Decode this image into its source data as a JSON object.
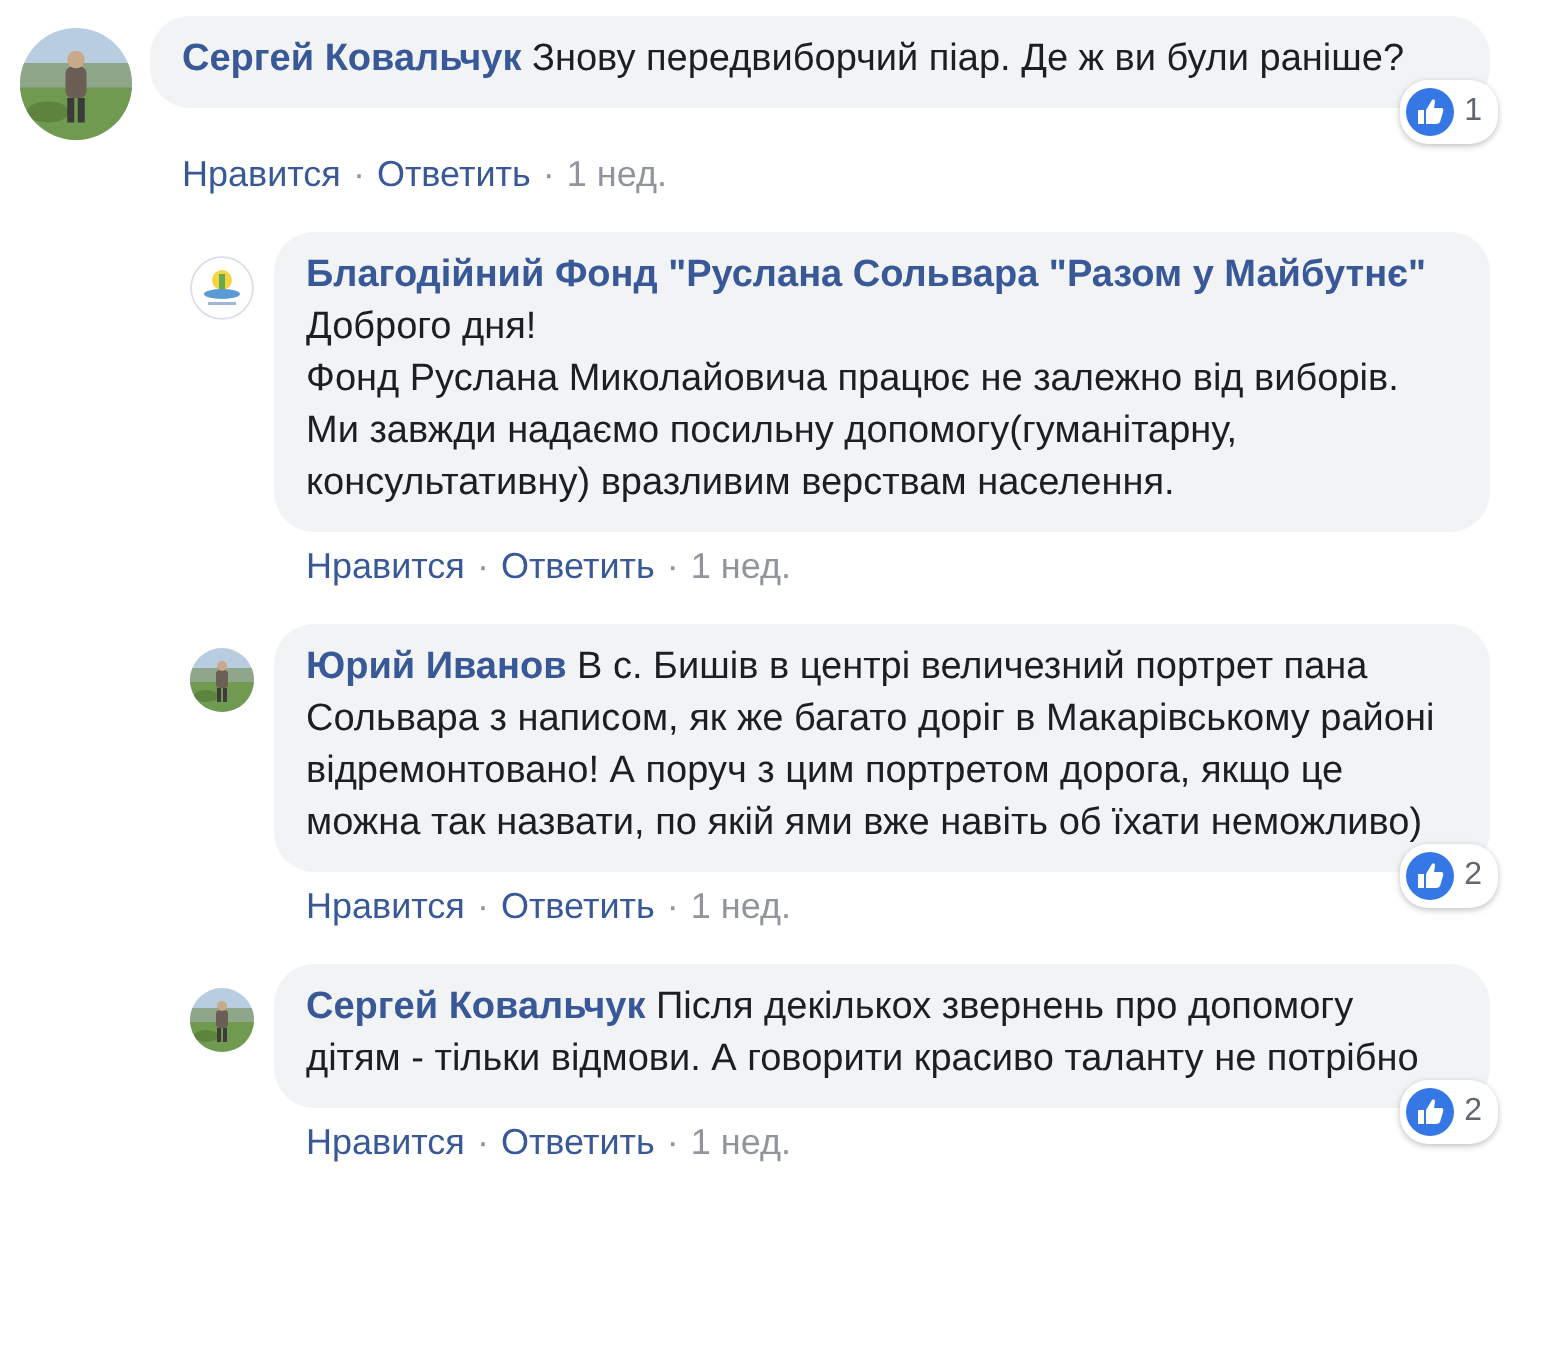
{
  "comments": [
    {
      "author": "Сергей Ковальчук",
      "avatar": {
        "kind": "picture"
      },
      "text": "Знову передвиборчий піар. Де ж ви були раніше?",
      "reactions": "1",
      "actions": [
        "Нравится",
        "Ответить"
      ],
      "separator": "·",
      "time": "1 нед.",
      "replies": [
        {
          "author": "Благодійний Фонд \"Руслана Сольвара \"Разом у Майбутнє\"",
          "avatar": {
            "kind": "logo"
          },
          "text": "Доброго дня!\nФонд Руслана Миколайовича працює не залежно від виборів.\nМи завжди надаємо посильну допомогу(гуманітарну, консультативну) вразливим верствам населення.",
          "actions": [
            "Нравится",
            "Ответить"
          ],
          "separator": "·",
          "time": "1 нед."
        },
        {
          "author": "Юрий Иванов",
          "avatar": {
            "kind": "picture"
          },
          "text": "В с. Бишів в центрі величезний портрет пана Сольвара з написом, як же багато доріг в Макарівському районі відремонтовано! А поруч з цим портретом дорога, якщо це можна так назвати, по якій ями вже навіть об їхати неможливо)",
          "reactions": "2",
          "actions": [
            "Нравится",
            "Ответить"
          ],
          "separator": "·",
          "time": "1 нед."
        },
        {
          "author": "Сергей Ковальчук",
          "avatar": {
            "kind": "picture"
          },
          "text": "Після декількох звернень про допомогу дітям - тільки відмови. А говорити красиво таланту не потрібно",
          "reactions": "2",
          "actions": [
            "Нравится",
            "Ответить"
          ],
          "separator": "·",
          "time": "1 нед."
        }
      ]
    }
  ]
}
